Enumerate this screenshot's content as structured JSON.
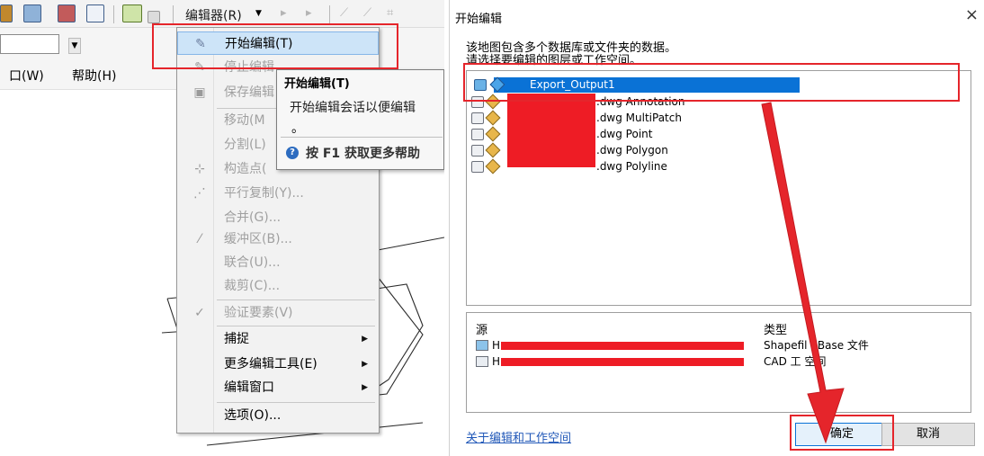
{
  "left": {
    "menu_title": "编辑器(R)",
    "menubar": [
      "口(W)",
      "帮助(H)"
    ],
    "menu_items": [
      {
        "label": "开始编辑(T)",
        "enabled": true,
        "icon": "pencil-icon"
      },
      {
        "label": "停止编辑",
        "enabled": false,
        "icon": "stop-edit-icon"
      },
      {
        "label": "保存编辑",
        "enabled": false,
        "icon": "save-icon"
      },
      {
        "label": "移动(M",
        "enabled": false
      },
      {
        "label": "分割(L)",
        "enabled": false
      },
      {
        "label": "构造点(",
        "enabled": false,
        "icon": "construct-points-icon"
      },
      {
        "label": "平行复制(Y)...",
        "enabled": false,
        "icon": "copy-parallel-icon"
      },
      {
        "label": "合并(G)...",
        "enabled": false
      },
      {
        "label": "缓冲区(B)...",
        "enabled": false,
        "icon": "buffer-icon"
      },
      {
        "label": "联合(U)...",
        "enabled": false
      },
      {
        "label": "裁剪(C)...",
        "enabled": false
      },
      {
        "label": "验证要素(V)",
        "enabled": false,
        "icon": "validate-icon"
      },
      {
        "label": "捕捉",
        "enabled": true,
        "submenu": true
      },
      {
        "label": "更多编辑工具(E)",
        "enabled": true,
        "submenu": true
      },
      {
        "label": "编辑窗口",
        "enabled": true,
        "submenu": true
      },
      {
        "label": "选项(O)...",
        "enabled": true
      }
    ],
    "tooltip": {
      "title": "开始编辑(T)",
      "body": "开始编辑会话以便编辑",
      "body2": "。",
      "help": "按 F1 获取更多帮助"
    }
  },
  "dialog": {
    "title": "开始编辑",
    "close_glyph": "×",
    "message_line1": "该地图包含多个数据库或文件夹的数据。",
    "message_line2": "请选择要编辑的图层或工作空间。",
    "layers": [
      {
        "name": "Export_Output1",
        "selected": true
      },
      {
        "name": ".dwg Annotation",
        "selected": false
      },
      {
        "name": ".dwg MultiPatch",
        "selected": false
      },
      {
        "name": ".dwg Point",
        "selected": false
      },
      {
        "name": ".dwg Polygon",
        "selected": false
      },
      {
        "name": ".dwg Polyline",
        "selected": false
      }
    ],
    "table": {
      "col_source": "源",
      "col_type": "类型",
      "rows": [
        {
          "source": "H",
          "type": "Shapefil dBase 文件"
        },
        {
          "source": "H",
          "type": "CAD 工 空间"
        }
      ]
    },
    "help_link": "关于编辑和工作空间",
    "ok_label": "确定",
    "cancel_label": "取消"
  },
  "colors": {
    "highlight_red": "#e5252b",
    "selection_blue": "#0a72d6",
    "redaction": "#ee1c25"
  }
}
